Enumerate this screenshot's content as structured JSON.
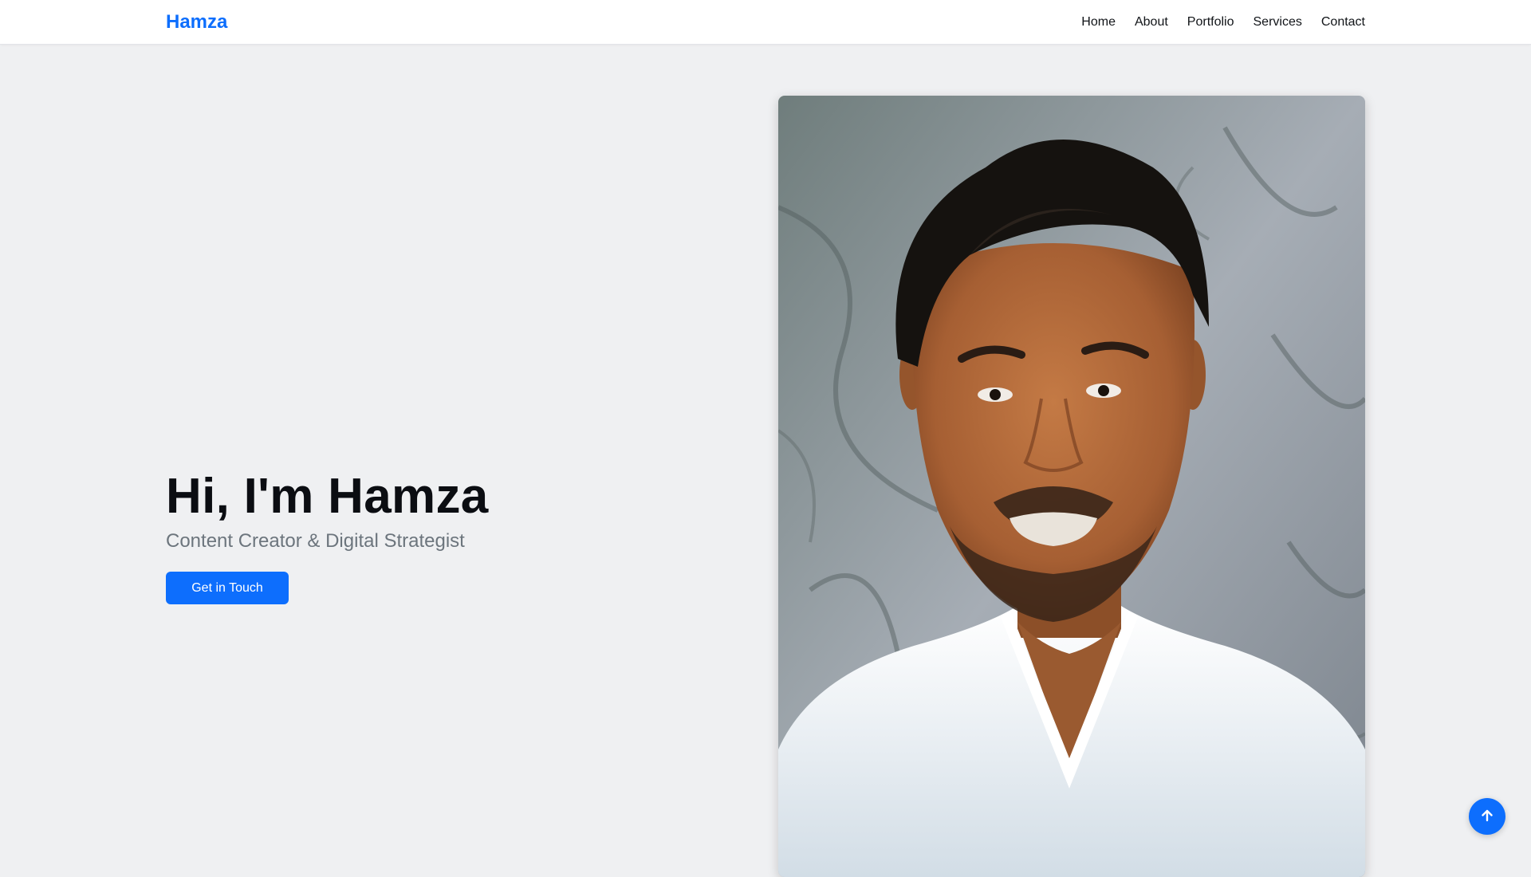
{
  "nav": {
    "brand": "Hamza",
    "links": [
      "Home",
      "About",
      "Portfolio",
      "Services",
      "Contact"
    ]
  },
  "hero": {
    "title": "Hi, I'm Hamza",
    "subtitle": "Content Creator & Digital Strategist",
    "cta_label": "Get in Touch"
  },
  "portrait": {
    "icon": "portrait-photo"
  },
  "scroll_top": {
    "icon": "arrow-up-icon"
  },
  "colors": {
    "accent": "#0d6efd",
    "background": "#eff0f2",
    "navbar": "#ffffff",
    "title_text": "#0b0d12",
    "subtitle_text": "#6c757d"
  }
}
